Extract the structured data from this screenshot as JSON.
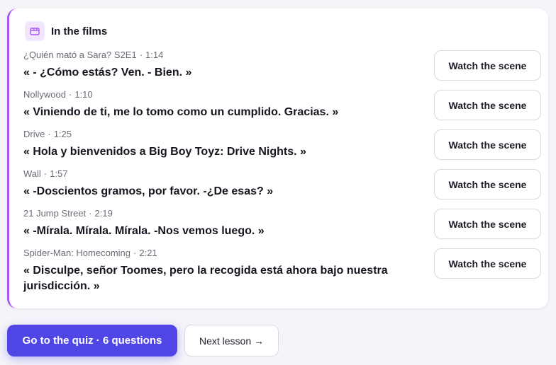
{
  "section": {
    "title": "In the films",
    "icon": "clapperboard-icon",
    "accent_color": "#a855f7"
  },
  "scenes": [
    {
      "source": "¿Quién mató a Sara? S2E1",
      "time": "1:14",
      "quote": "« - ¿Cómo estás? Ven. - Bien. »",
      "button": "Watch the scene"
    },
    {
      "source": "Nollywood",
      "time": "1:10",
      "quote": "« Viniendo de ti, me lo tomo como un cumplido. Gracias. »",
      "button": "Watch the scene"
    },
    {
      "source": "Drive",
      "time": "1:25",
      "quote": "« Hola y bienvenidos a Big Boy Toyz: Drive Nights. »",
      "button": "Watch the scene"
    },
    {
      "source": "Wall",
      "time": "1:57",
      "quote": "« -Doscientos gramos, por favor. -¿De esas? »",
      "button": "Watch the scene"
    },
    {
      "source": "21 Jump Street",
      "time": "2:19",
      "quote": "« -Mírala. Mírala. Mírala. -Nos vemos luego. »",
      "button": "Watch the scene"
    },
    {
      "source": "Spider-Man: Homecoming",
      "time": "2:21",
      "quote": "« Disculpe, señor Toomes, pero la recogida está ahora bajo nuestra jurisdicción. »",
      "button": "Watch the scene"
    }
  ],
  "separator": "·",
  "footer": {
    "quiz_label": "Go to the quiz · 6 questions",
    "next_label": "Next lesson →",
    "primary_color": "#4f46e5"
  }
}
